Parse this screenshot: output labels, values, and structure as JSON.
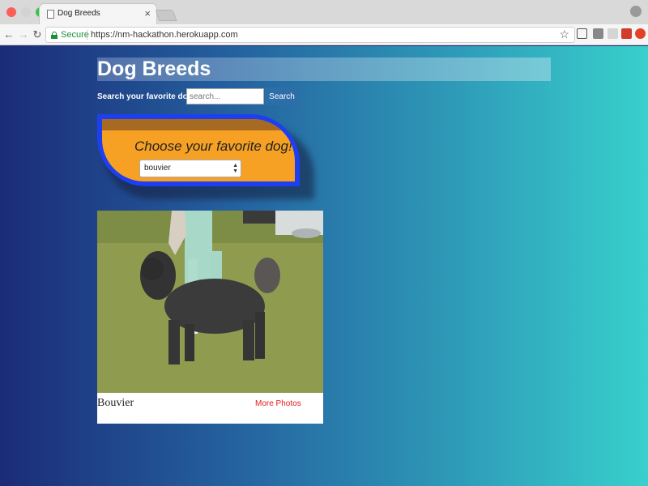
{
  "browser": {
    "tab_title": "Dog Breeds",
    "tab_close": "×",
    "secure_label": "Secure",
    "url": "https://nm-hackathon.herokuapp.com"
  },
  "header": {
    "title": "Dog Breeds"
  },
  "search": {
    "label": "Search your favorite dog:",
    "placeholder": "search...",
    "button_label": "Search"
  },
  "chooser": {
    "prompt": "Choose your favorite dog!",
    "selected": "bouvier"
  },
  "card": {
    "breed_name": "Bouvier",
    "more_photos_label": "More Photos"
  },
  "colors": {
    "page_gradient_start": "#1b2b78",
    "page_gradient_end": "#38d0cc",
    "chooser_border": "#1e3ff0",
    "chooser_fill": "#f7a124",
    "link_red": "#e41b1b"
  }
}
